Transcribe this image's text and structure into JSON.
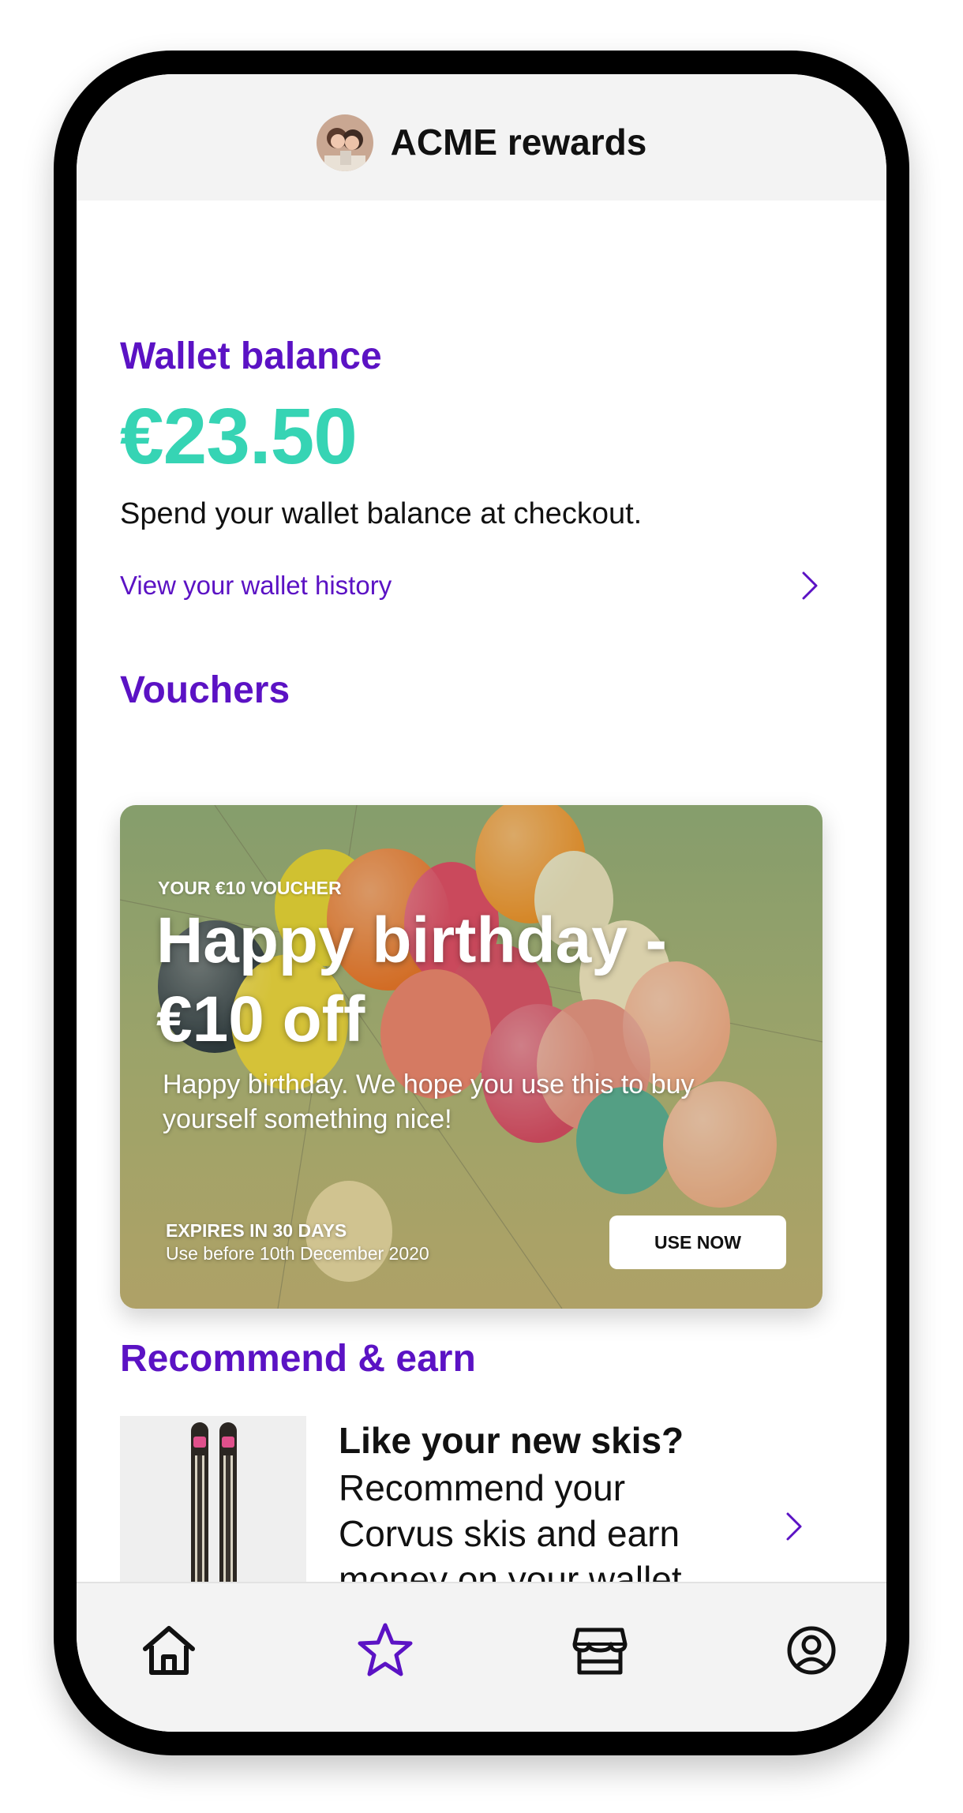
{
  "app": {
    "title": "ACME rewards",
    "avatar_icon": "user-photo-avatar"
  },
  "wallet": {
    "section_title": "Wallet balance",
    "balance": "€23.50",
    "description": "Spend your wallet balance at checkout.",
    "history_link": "View your wallet history"
  },
  "vouchers": {
    "section_title": "Vouchers",
    "items": [
      {
        "eyebrow": "YOUR €10 VOUCHER",
        "title": "Happy birthday - €10 off",
        "description": "Happy birthday. We hope you use this to buy yourself something nice!",
        "expiry_label": "EXPIRES IN 30 DAYS",
        "expiry_detail": "Use before 10th December 2020",
        "cta": "USE NOW",
        "background_icon": "balloons-image"
      }
    ]
  },
  "recommend": {
    "section_title": "Recommend & earn",
    "items": [
      {
        "title": "Like your new skis?",
        "description": "Recommend your Corvus skis and earn money on your wallet",
        "image_icon": "skis-image"
      }
    ]
  },
  "nav": {
    "items": [
      {
        "icon": "home-icon",
        "active": false
      },
      {
        "icon": "star-icon",
        "active": true
      },
      {
        "icon": "store-icon",
        "active": false
      },
      {
        "icon": "account-icon",
        "active": false
      }
    ]
  },
  "colors": {
    "accent": "#5b12c4",
    "balance": "#36d4b4",
    "header_bg": "#f3f3f3"
  }
}
